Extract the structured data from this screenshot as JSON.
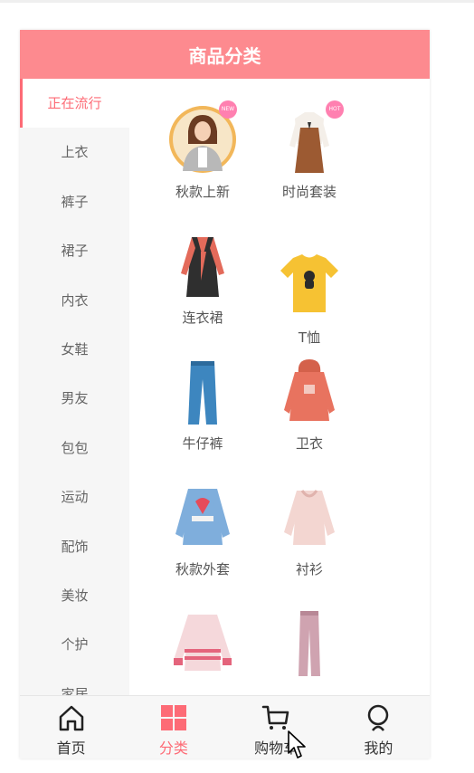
{
  "header": {
    "title": "商品分类"
  },
  "colors": {
    "brand": "#fd8a8f",
    "accent": "#fd6b76"
  },
  "sidebar": {
    "items": [
      {
        "label": "正在流行",
        "active": true
      },
      {
        "label": "上衣"
      },
      {
        "label": "裤子"
      },
      {
        "label": "裙子"
      },
      {
        "label": "内衣"
      },
      {
        "label": "女鞋"
      },
      {
        "label": "男友"
      },
      {
        "label": "包包"
      },
      {
        "label": "运动"
      },
      {
        "label": "配饰"
      },
      {
        "label": "美妆"
      },
      {
        "label": "个护"
      },
      {
        "label": "家居"
      }
    ]
  },
  "products": [
    {
      "label": "秋款上新",
      "icon": "model-photo-icon",
      "badge": "NEW"
    },
    {
      "label": "时尚套装",
      "icon": "outfit-set-icon",
      "badge": "HOT"
    },
    {
      "label": "连衣裙",
      "icon": "dress-icon"
    },
    {
      "label": "T恤",
      "icon": "tshirt-icon"
    },
    {
      "label": "牛仔裤",
      "icon": "jeans-icon"
    },
    {
      "label": "卫衣",
      "icon": "hoodie-icon"
    },
    {
      "label": "秋款外套",
      "icon": "denim-jacket-icon"
    },
    {
      "label": "衬衫",
      "icon": "blouse-icon"
    },
    {
      "label": "",
      "icon": "sweater-icon"
    },
    {
      "label": "",
      "icon": "trousers-icon"
    }
  ],
  "tabbar": {
    "items": [
      {
        "label": "首页",
        "icon": "home-icon"
      },
      {
        "label": "分类",
        "icon": "category-grid-icon",
        "active": true
      },
      {
        "label": "购物车",
        "icon": "cart-icon"
      },
      {
        "label": "我的",
        "icon": "profile-icon"
      }
    ]
  }
}
